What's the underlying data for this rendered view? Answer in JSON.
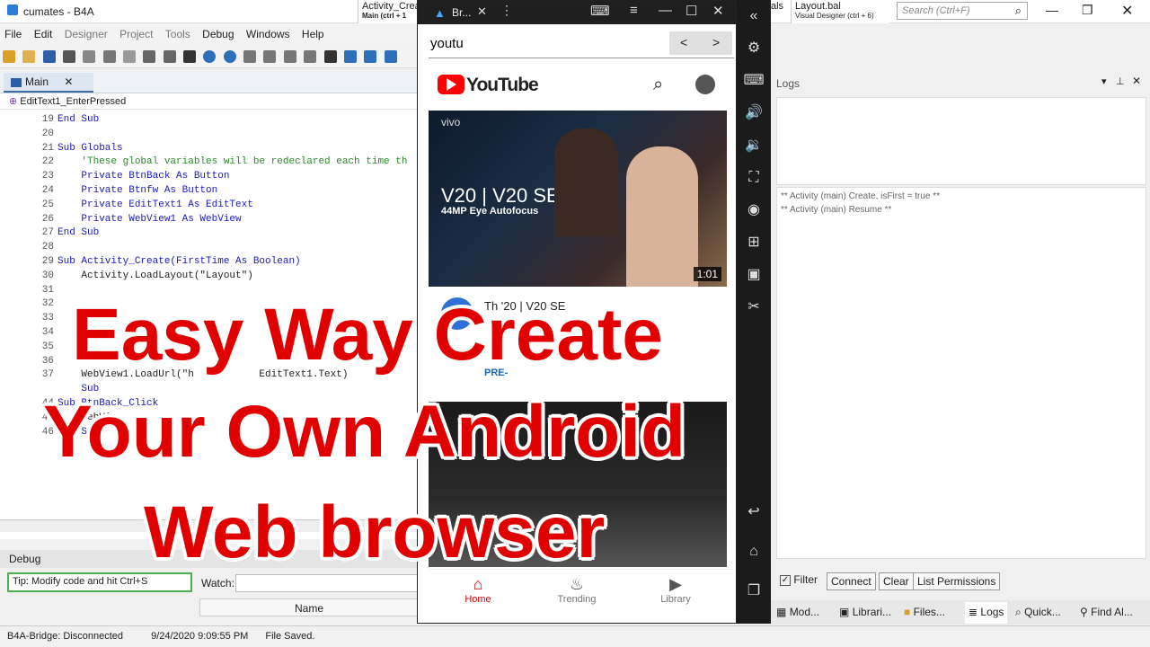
{
  "window": {
    "title": "cumates - B4A"
  },
  "ide_tabs": [
    {
      "title": "Activity_Crea",
      "sub": "Main  (ctrl + 1"
    },
    {
      "title": "als",
      "sub": ""
    },
    {
      "title": "Layout.bal",
      "sub": "Visual Designer  (ctrl + 6)"
    }
  ],
  "search": {
    "placeholder": "Search (Ctrl+F)"
  },
  "menu": [
    "File",
    "Edit",
    "Designer",
    "Project",
    "Tools",
    "Debug",
    "Windows",
    "Help"
  ],
  "editor": {
    "tab_label": "Main",
    "breadcrumb": "EditText1_EnterPressed",
    "lines": [
      {
        "n": "19",
        "t": "End Sub"
      },
      {
        "n": "20",
        "t": ""
      },
      {
        "n": "21",
        "t": "Sub Globals"
      },
      {
        "n": "22",
        "t": "    'These global variables will be redeclared each time th"
      },
      {
        "n": "23",
        "t": "    Private BtnBack As Button"
      },
      {
        "n": "24",
        "t": "    Private Btnfw As Button"
      },
      {
        "n": "25",
        "t": "    Private EditText1 As EditText"
      },
      {
        "n": "26",
        "t": "    Private WebView1 As WebView"
      },
      {
        "n": "27",
        "t": "End Sub"
      },
      {
        "n": "28",
        "t": ""
      },
      {
        "n": "29",
        "t": "Sub Activity_Create(FirstTime As Boolean)"
      },
      {
        "n": "30",
        "t": "    Activity.LoadLayout(\"Layout\")"
      },
      {
        "n": "31",
        "t": ""
      },
      {
        "n": "32",
        "t": ""
      },
      {
        "n": "33",
        "t": ""
      },
      {
        "n": "34",
        "t": ""
      },
      {
        "n": "35",
        "t": ""
      },
      {
        "n": "36",
        "t": ""
      },
      {
        "n": "37",
        "t": "    WebView1.LoadUrl(\"h           EditText1.Text)"
      },
      {
        "n": "",
        "t": "    Sub"
      },
      {
        "n": "44",
        "t": "Sub BtnBack_Click"
      },
      {
        "n": "45",
        "t": "    WebVie"
      },
      {
        "n": "46",
        "t": "End Sub"
      }
    ]
  },
  "debug": {
    "label": "Debug",
    "tip": "Tip: Modify code and hit Ctrl+S",
    "watch_label": "Watch:",
    "name_header": "Name"
  },
  "device": {
    "title": "Br...",
    "url_value": "youtu",
    "back_label": "<",
    "fwd_label": ">",
    "youtube_word": "YouTube",
    "ad_brand": "vivo",
    "ad_headline": "V20 | V20 SE",
    "ad_sub": "44MP Eye Autofocus",
    "duration": "1:01",
    "video_title_partial": "Th            '20 | V20 SE",
    "pre_label": "PRE-",
    "nav": [
      {
        "label": "Home",
        "icon": "home-icon"
      },
      {
        "label": "Trending",
        "icon": "flame-icon"
      },
      {
        "label": "Library",
        "icon": "library-icon"
      }
    ]
  },
  "logs": {
    "title": "Logs",
    "lines": [
      "** Activity (main) Create, isFirst = true **",
      "** Activity (main) Resume **"
    ],
    "filter_label": "Filter",
    "connect_label": "Connect",
    "clear_label": "Clear",
    "list_permissions_label": "List Permissions"
  },
  "bottom_tabs": [
    "Mod...",
    "Librari...",
    "Files...",
    "Logs",
    "Quick...",
    "Find Al..."
  ],
  "status": {
    "bridge": "B4A-Bridge: Disconnected",
    "time": "9/24/2020 9:09:55 PM",
    "saved": "File Saved."
  },
  "overlay": {
    "line1": "Easy Way Create",
    "line2": "Your Own Android",
    "line3": "Web browser"
  },
  "colors": {
    "accent": "#e00000",
    "youtube_red": "#ff0000",
    "ide_blue": "#3b6ea5"
  }
}
